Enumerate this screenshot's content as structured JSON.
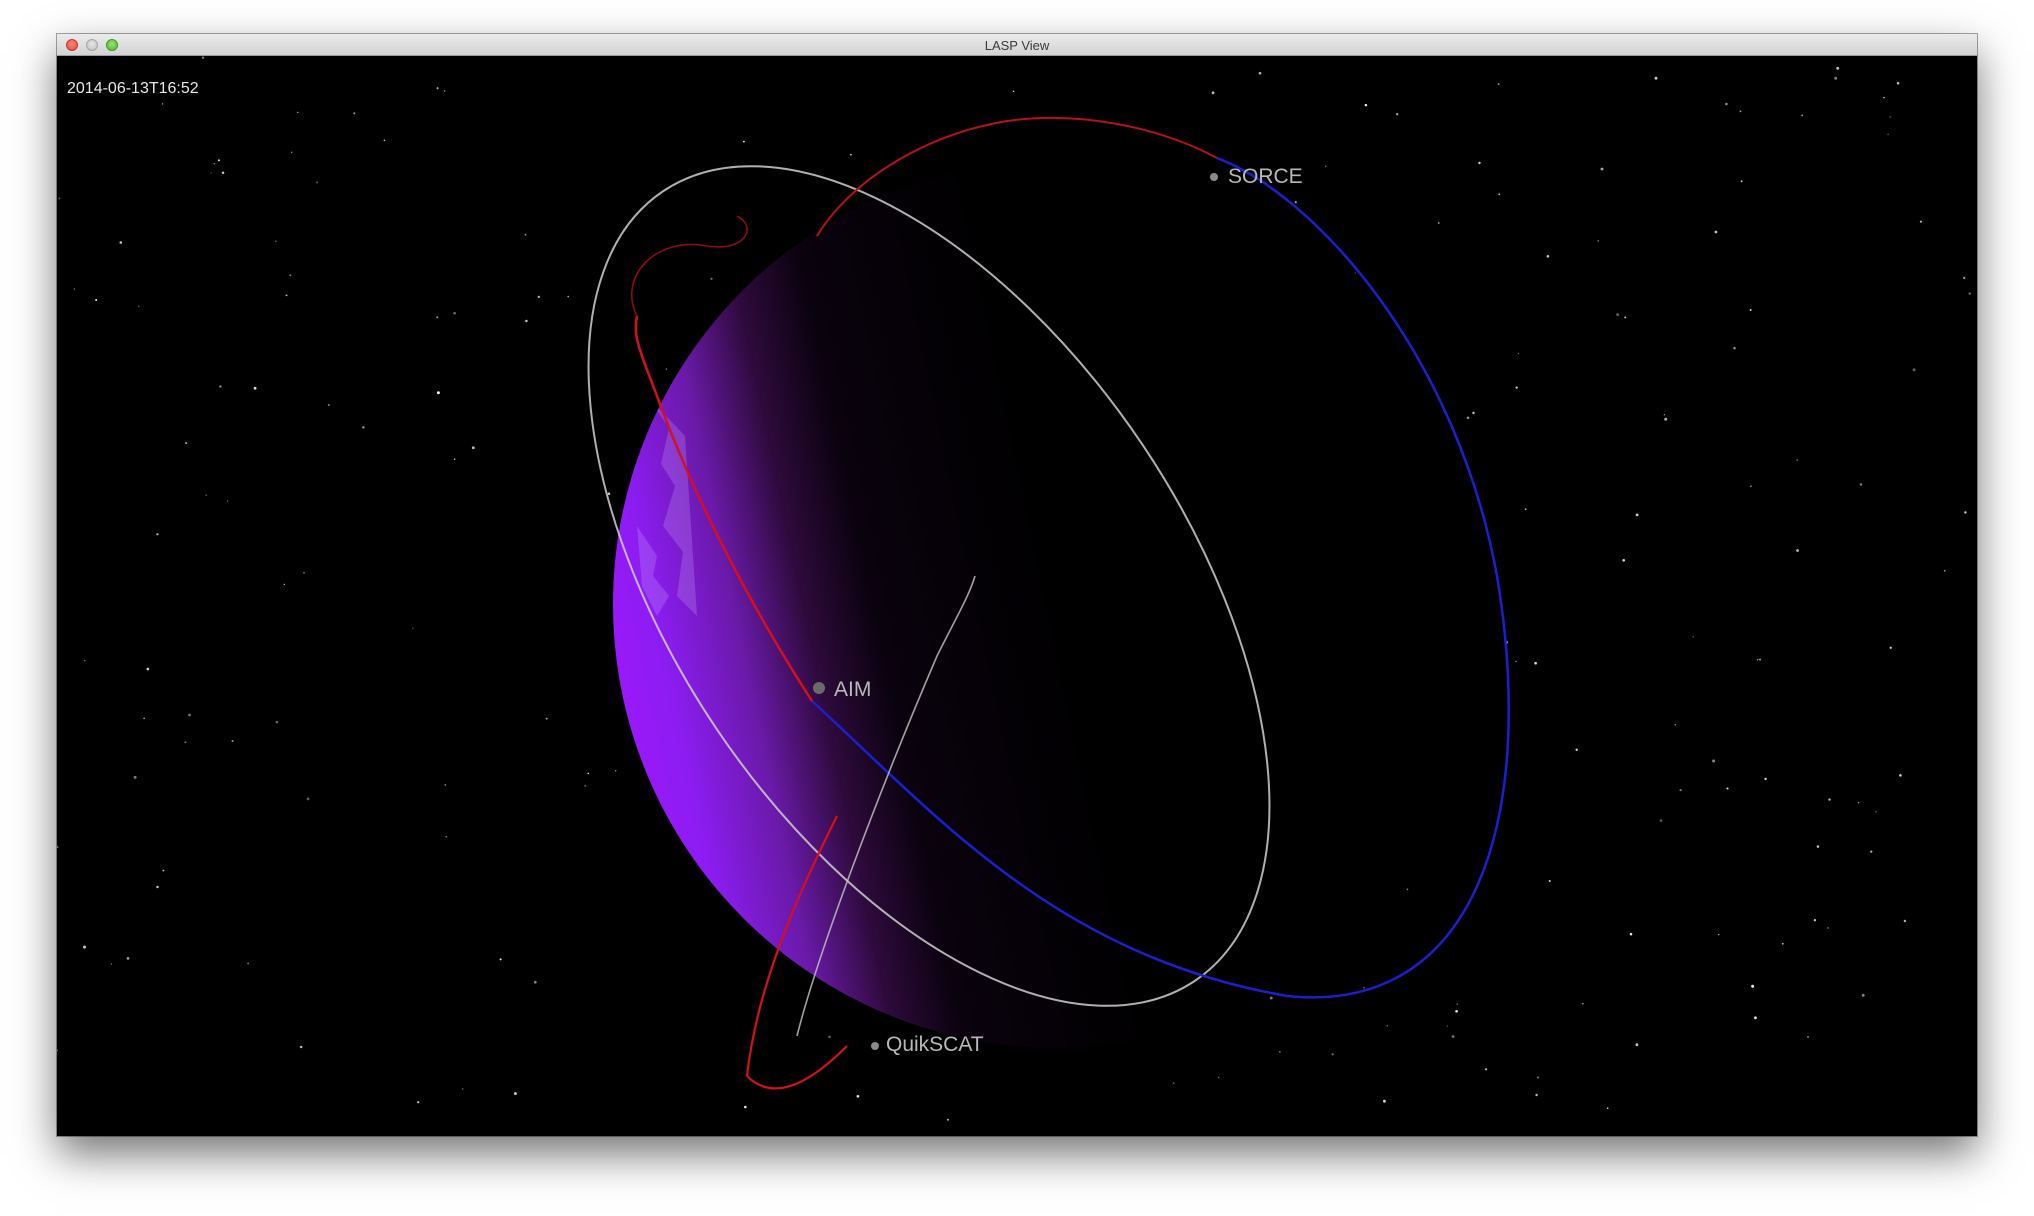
{
  "window": {
    "title": "LASP View",
    "controls": {
      "close": "close-icon",
      "minimize": "minimize-icon",
      "zoom": "zoom-icon"
    }
  },
  "scene": {
    "timestamp": "2014-06-13T16:52",
    "background_color": "#000000",
    "earth": {
      "lit_color": "#9a1aff",
      "night_color": "#000000"
    },
    "satellites": [
      {
        "name": "SORCE",
        "marker_icon": "satellite-icon"
      },
      {
        "name": "AIM",
        "marker_icon": "satellite-icon"
      },
      {
        "name": "QuikSCAT",
        "marker_icon": "satellite-icon"
      }
    ],
    "orbit_colors": {
      "past": "#d4101a",
      "future": "#1a20d0",
      "reference": "#cfcfcf"
    }
  }
}
